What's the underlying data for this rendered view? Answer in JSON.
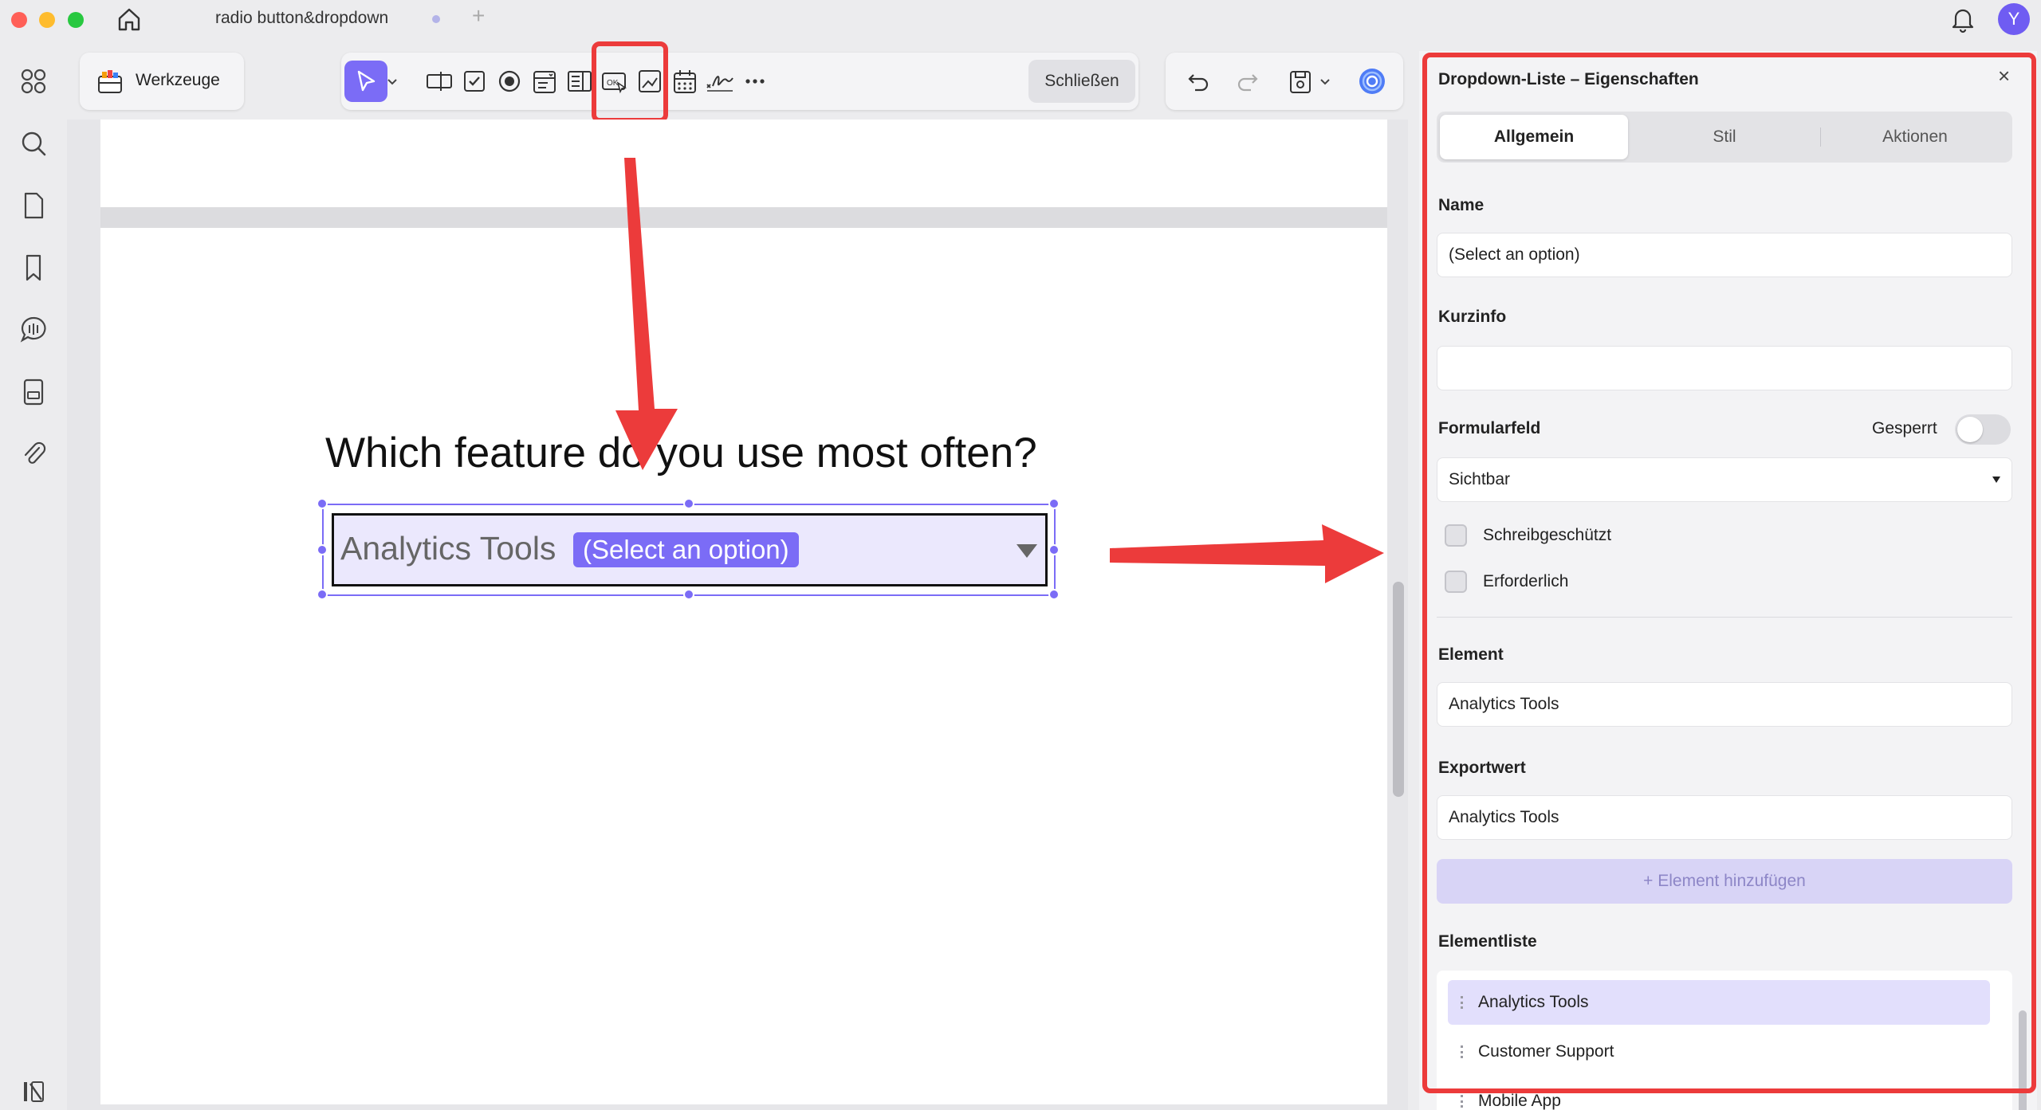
{
  "titlebar": {
    "tab_title": "radio button&dropdown",
    "avatar_initial": "Y"
  },
  "toolbar": {
    "tools_label": "Werkzeuge",
    "close_label": "Schließen"
  },
  "document": {
    "question": "Which feature do you use most often?",
    "dropdown_value": "Analytics Tools",
    "dropdown_placeholder": "(Select an option)"
  },
  "panel": {
    "title": "Dropdown-Liste – Eigenschaften",
    "close_glyph": "×",
    "tabs": [
      "Allgemein",
      "Stil",
      "Aktionen"
    ],
    "name_label": "Name",
    "name_value": "(Select an option)",
    "tooltip_label": "Kurzinfo",
    "tooltip_value": "",
    "form_field_label": "Formularfeld",
    "locked_label": "Gesperrt",
    "visibility_value": "Sichtbar",
    "readonly_label": "Schreibgeschützt",
    "required_label": "Erforderlich",
    "element_label": "Element",
    "element_value": "Analytics Tools",
    "export_label": "Exportwert",
    "export_value": "Analytics Tools",
    "add_element_label": "+ Element hinzufügen",
    "list_label": "Elementliste",
    "list_items": [
      "Analytics Tools",
      "Customer Support",
      "Mobile App"
    ]
  },
  "colors": {
    "accent": "#7b6cf6",
    "annotation_red": "#ec3b3b"
  },
  "icons": [
    "home-icon",
    "bell-icon",
    "grid-icon",
    "search-icon",
    "page-icon",
    "bookmark-icon",
    "comment-icon",
    "form-icon",
    "attachment-icon",
    "sidebar-toggle-icon",
    "toolbox-icon",
    "cursor-icon",
    "text-field-icon",
    "checkbox-icon",
    "radio-icon",
    "dropdown-list-icon",
    "list-box-icon",
    "button-icon",
    "image-icon",
    "date-icon",
    "signature-icon",
    "more-icon",
    "undo-icon",
    "redo-icon",
    "save-icon",
    "ai-assistant-icon"
  ]
}
